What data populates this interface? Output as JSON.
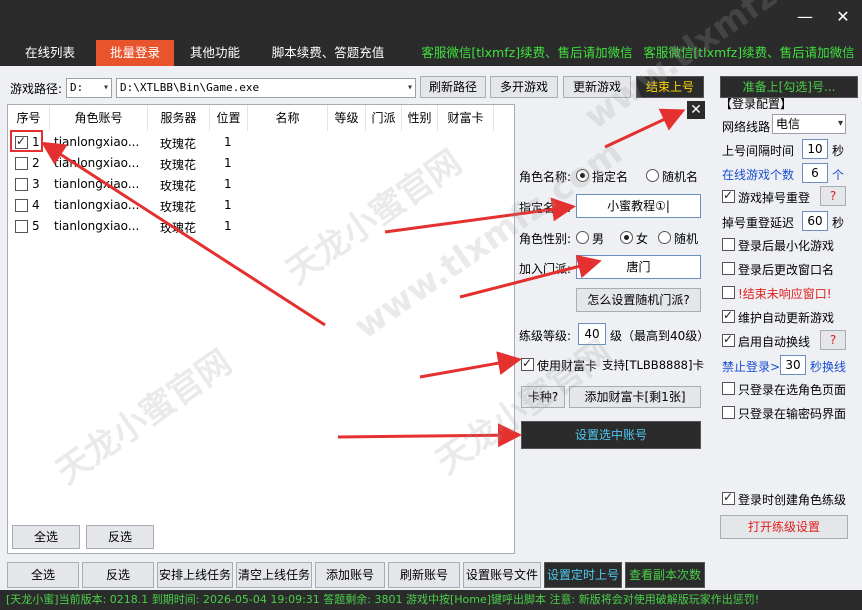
{
  "window": {
    "minimize": "—",
    "close": "✕"
  },
  "tabs": [
    {
      "label": "在线列表",
      "active": false
    },
    {
      "label": "批量登录",
      "active": true
    },
    {
      "label": "其他功能",
      "active": false
    },
    {
      "label": "脚本续费、答题充值",
      "active": false
    },
    {
      "label": "客服微信[tlxmfz]续费、售后请加微信",
      "active": false
    },
    {
      "label": "客服微信[tlxmfz]续费、售后请加微信",
      "active": false
    }
  ],
  "path": {
    "label": "游戏路径:",
    "drive": "D:",
    "value": "D:\\XTLBB\\Bin\\Game.exe",
    "refresh": "刷新路径",
    "multi": "多开游戏",
    "update": "更新游戏",
    "end_login": "结束上号"
  },
  "table": {
    "headers": [
      "序号",
      "角色账号",
      "服务器",
      "位置",
      "名称",
      "等级",
      "门派",
      "性别",
      "财富卡"
    ],
    "rows": [
      {
        "no": "1",
        "account": "tianlongxiao...",
        "server": "玫瑰花",
        "pos": "1",
        "checked": true
      },
      {
        "no": "2",
        "account": "tianlongxiao...",
        "server": "玫瑰花",
        "pos": "1",
        "checked": false
      },
      {
        "no": "3",
        "account": "tianlongxiao...",
        "server": "玫瑰花",
        "pos": "1",
        "checked": false
      },
      {
        "no": "4",
        "account": "tianlongxiao...",
        "server": "玫瑰花",
        "pos": "1",
        "checked": false
      },
      {
        "no": "5",
        "account": "tianlongxiao...",
        "server": "玫瑰花",
        "pos": "1",
        "checked": false
      }
    ],
    "select_all": "全选",
    "invert": "反选"
  },
  "config": {
    "role_name_label": "角色名称:",
    "opt_specified": "指定名",
    "opt_random": "随机名",
    "specified_name_label": "指定名称:",
    "specified_name_value": "小蜜教程①|",
    "gender_label": "角色性别:",
    "male": "男",
    "female": "女",
    "random": "随机",
    "faction_label": "加入门派:",
    "faction_value": "唐门",
    "how_random_faction": "怎么设置随机门派?",
    "level_label": "练级等级:",
    "level_value": "40",
    "level_hint": "级（最高到40级）",
    "use_card": "使用财富卡",
    "support_card": "支持[TLBB8888]卡",
    "card_type": "卡种?",
    "add_card": "添加财富卡[剩1张]",
    "set_selected": "设置选中账号"
  },
  "right": {
    "ready": "准备上[勾选]号...",
    "section": "【登录配置】",
    "line_label": "网络线路",
    "line_value": "电信",
    "interval_label": "上号间隔时间",
    "interval_value": "10",
    "sec": "秒",
    "online_label": "在线游戏个数",
    "online_value": "6",
    "unit": "个",
    "relog_label": "游戏掉号重登",
    "q": "?",
    "relog_delay_label": "掉号重登延迟",
    "relog_delay_value": "60",
    "minimize": "登录后最小化游戏",
    "rename": "登录后更改窗口名",
    "kill_hang": "!结束未响应窗口!",
    "auto_update": "维护自动更新游戏",
    "auto_switch": "启用自动换线",
    "ban_label": "禁止登录>",
    "ban_value": "30",
    "ban_unit": "秒换线",
    "only_select": "只登录在选角色页面",
    "only_pwd": "只登录在输密码界面",
    "create_level": "登录时创建角色练级",
    "open_level": "打开练级设置"
  },
  "bottom": [
    "全选",
    "反选",
    "安排上线任务",
    "清空上线任务",
    "添加账号",
    "刷新账号",
    "设置账号文件",
    "设置定时上号",
    "查看副本次数"
  ],
  "status": "[天龙小蜜]当前版本: 0218.1   到期时间: 2026-05-04 19:09:31   答题剩余: 3801   游戏中按[Home]键呼出脚本   注意: 新版将会对使用破解版玩家作出惩罚!",
  "watermark": [
    "天龙小蜜官网",
    "www.tlxmfz.com"
  ]
}
